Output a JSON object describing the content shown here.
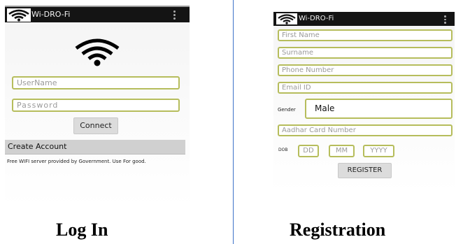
{
  "login_screen": {
    "app_title": "Wi-DRO-Fi",
    "username_placeholder": "UserName",
    "password_placeholder": "Password",
    "connect_label": "Connect",
    "create_account_label": "Create Account",
    "footer_text": "Free WIFI server provided by Government. Use For good.",
    "caption": "Log In"
  },
  "registration_screen": {
    "app_title": "Wi-DRO-Fi",
    "first_name_placeholder": "First Name",
    "surname_placeholder": "Surname",
    "phone_placeholder": "Phone Number",
    "email_placeholder": "Email ID",
    "gender_label": "Gender",
    "gender_value": "Male",
    "aadhar_placeholder": "Aadhar Card Number",
    "dob_label": "DOB",
    "dob_day_placeholder": "DD",
    "dob_month_placeholder": "MM",
    "dob_year_placeholder": "YYYY",
    "register_label": "REGISTER",
    "caption": "Registration"
  },
  "colors": {
    "appbar": "#141414",
    "field_border": "#b6bd5c",
    "create_account_bar": "#d0d0d0",
    "divider": "#3d72c9"
  },
  "icons": [
    "wifi-icon",
    "overflow-menu-icon"
  ]
}
